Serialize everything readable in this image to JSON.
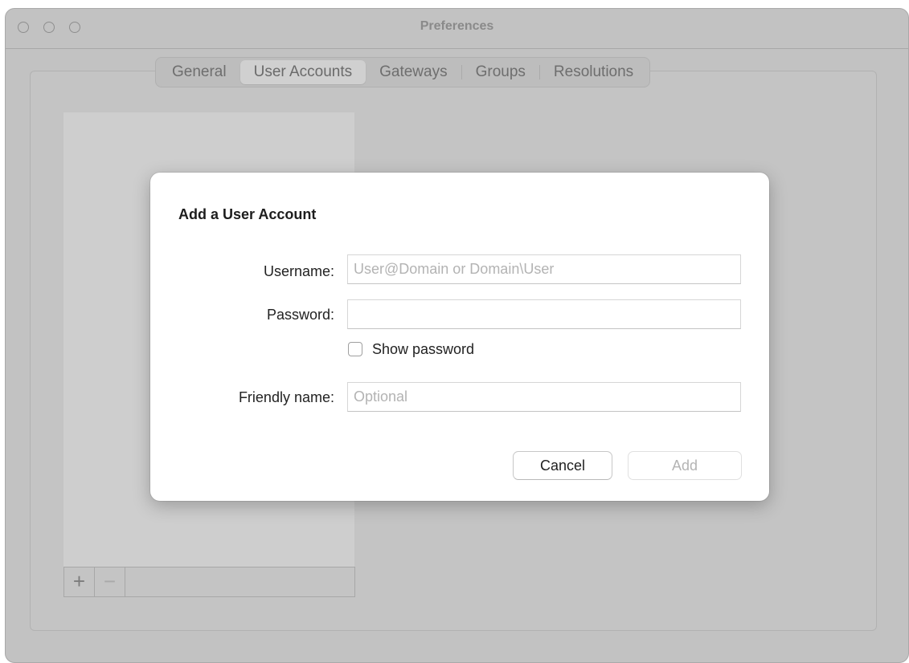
{
  "window": {
    "title": "Preferences"
  },
  "tabs": [
    {
      "label": "General"
    },
    {
      "label": "User Accounts"
    },
    {
      "label": "Gateways"
    },
    {
      "label": "Groups"
    },
    {
      "label": "Resolutions"
    }
  ],
  "active_tab": "User Accounts",
  "list": {
    "add_button_icon": "plus-icon",
    "add_button_label": "+",
    "remove_button_icon": "minus-icon",
    "remove_button_label": "−"
  },
  "dialog": {
    "title": "Add a User Account",
    "username": {
      "label": "Username:",
      "value": "",
      "placeholder": "User@Domain or Domain\\User"
    },
    "password": {
      "label": "Password:",
      "value": "",
      "placeholder": ""
    },
    "show_password": {
      "label": "Show password",
      "checked": false
    },
    "friendly_name": {
      "label": "Friendly name:",
      "value": "",
      "placeholder": "Optional"
    },
    "cancel_label": "Cancel",
    "add_label": "Add"
  }
}
